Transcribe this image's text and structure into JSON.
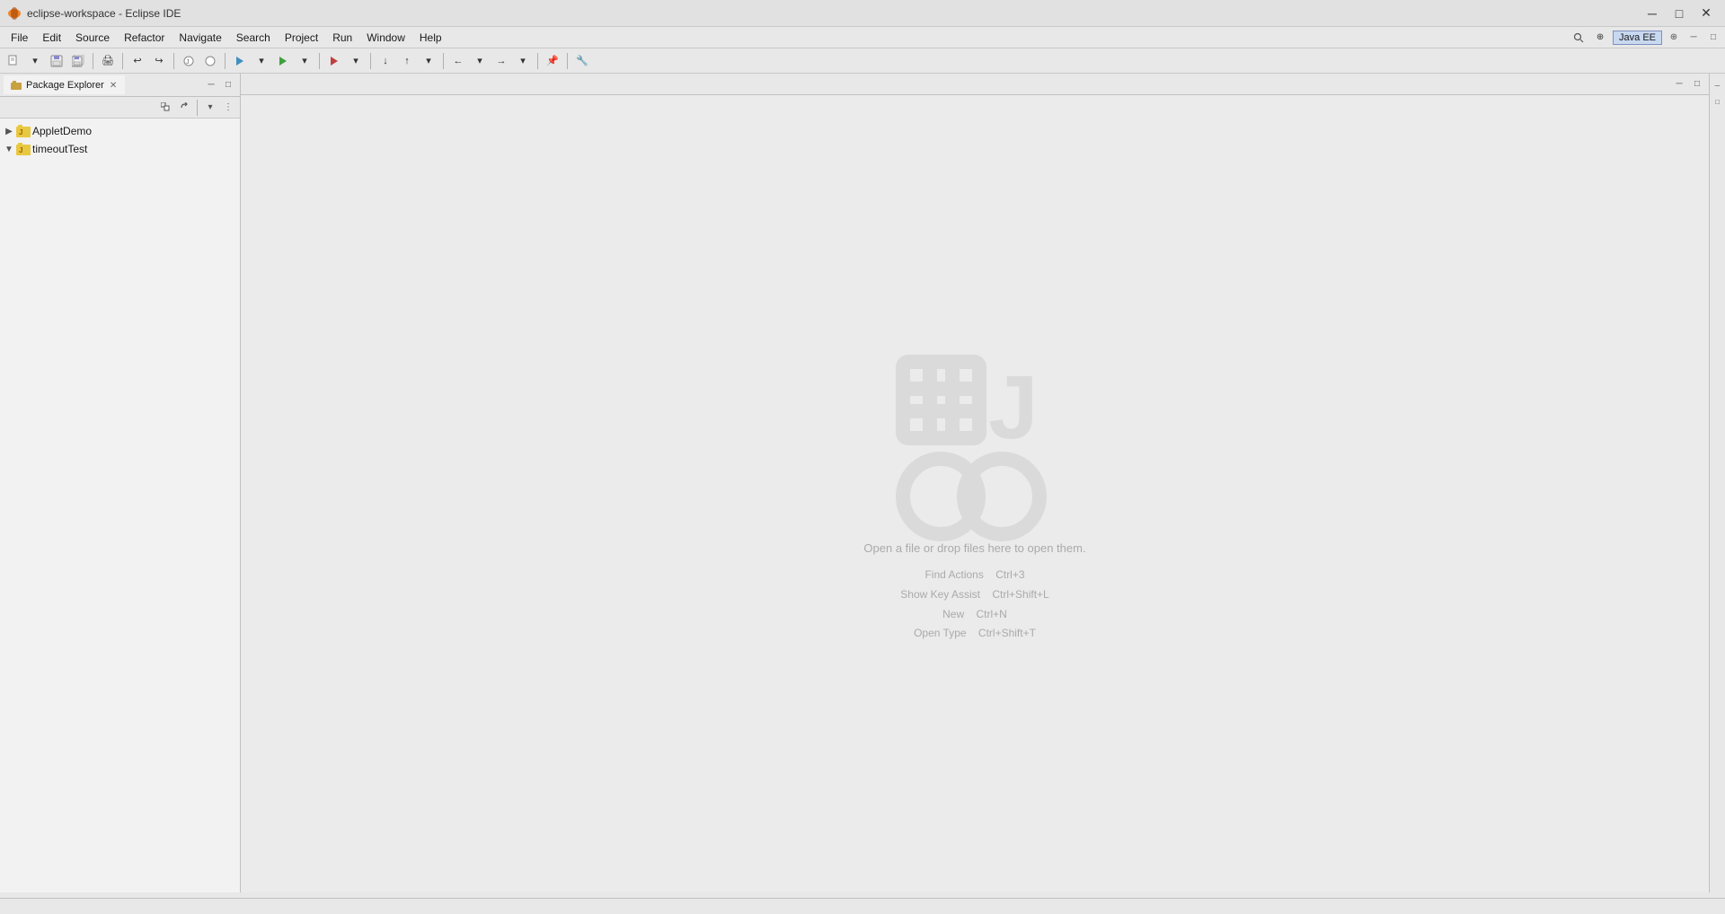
{
  "titlebar": {
    "title": "eclipse-workspace - Eclipse IDE",
    "minimize_label": "─",
    "maximize_label": "□",
    "close_label": "✕"
  },
  "menubar": {
    "items": [
      {
        "id": "file",
        "label": "File"
      },
      {
        "id": "edit",
        "label": "Edit"
      },
      {
        "id": "source",
        "label": "Source"
      },
      {
        "id": "refactor",
        "label": "Refactor"
      },
      {
        "id": "navigate",
        "label": "Navigate"
      },
      {
        "id": "search",
        "label": "Search"
      },
      {
        "id": "project",
        "label": "Project"
      },
      {
        "id": "run",
        "label": "Run"
      },
      {
        "id": "window",
        "label": "Window"
      },
      {
        "id": "help",
        "label": "Help"
      }
    ]
  },
  "package_explorer": {
    "title": "Package Explorer",
    "projects": [
      {
        "id": "applet-demo",
        "name": "AppletDemo",
        "type": "java-project",
        "expanded": false
      },
      {
        "id": "timeout-test",
        "name": "timeoutTest",
        "type": "java-project",
        "expanded": true
      }
    ]
  },
  "editor": {
    "drop_hint": "Open a file or drop files here to open them.",
    "shortcuts": [
      {
        "label": "Find Actions",
        "shortcut": "Ctrl+3"
      },
      {
        "label": "Show Key Assist",
        "shortcut": "Ctrl+Shift+L"
      },
      {
        "label": "New",
        "shortcut": "Ctrl+N"
      },
      {
        "label": "Open Type",
        "shortcut": "Ctrl+Shift+T"
      }
    ]
  },
  "perspective": {
    "label": "Java EE",
    "open_label": "⊕"
  }
}
